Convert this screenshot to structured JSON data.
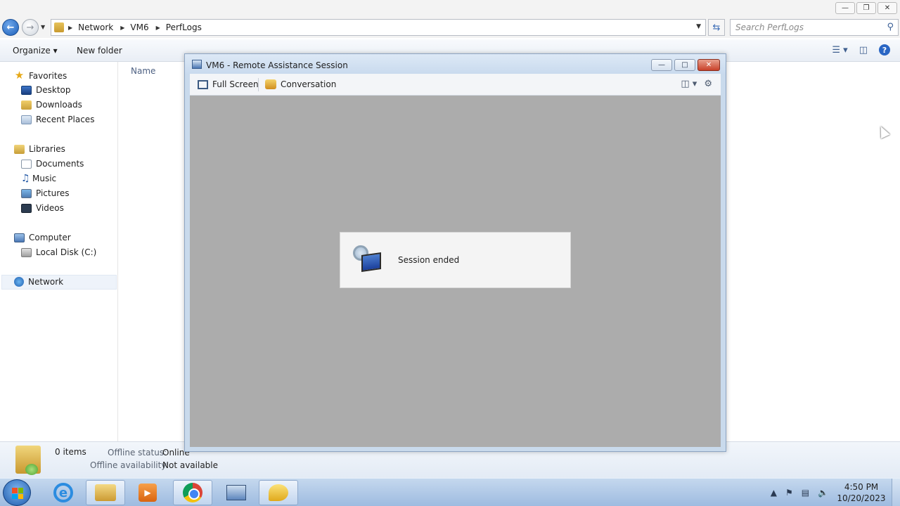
{
  "explorer": {
    "breadcrumb": [
      "Network",
      "VM6",
      "PerfLogs"
    ],
    "search_placeholder": "Search PerfLogs",
    "commands": {
      "organize": "Organize",
      "new_folder": "New folder"
    },
    "column_header": "Name",
    "nav": {
      "favorites": {
        "label": "Favorites",
        "items": [
          "Desktop",
          "Downloads",
          "Recent Places"
        ]
      },
      "libraries": {
        "label": "Libraries",
        "items": [
          "Documents",
          "Music",
          "Pictures",
          "Videos"
        ]
      },
      "computer": {
        "label": "Computer",
        "items": [
          "Local Disk (C:)"
        ]
      },
      "network": {
        "label": "Network"
      }
    },
    "status": {
      "items_count": "0 items",
      "offline_status_label": "Offline status:",
      "offline_status_value": "Online",
      "offline_availability_label": "Offline availability:",
      "offline_availability_value": "Not available"
    }
  },
  "remote_assistance": {
    "title": "VM6 - Remote Assistance Session",
    "toolbar": {
      "full_screen": "Full Screen",
      "conversation": "Conversation"
    },
    "message": "Session ended"
  },
  "taskbar": {
    "time": "4:50 PM",
    "date": "10/20/2023"
  },
  "colors": {
    "canvas_gray": "#acacac",
    "close_red": "#c8412a",
    "taskbar_blue": "#9ebbe0"
  }
}
